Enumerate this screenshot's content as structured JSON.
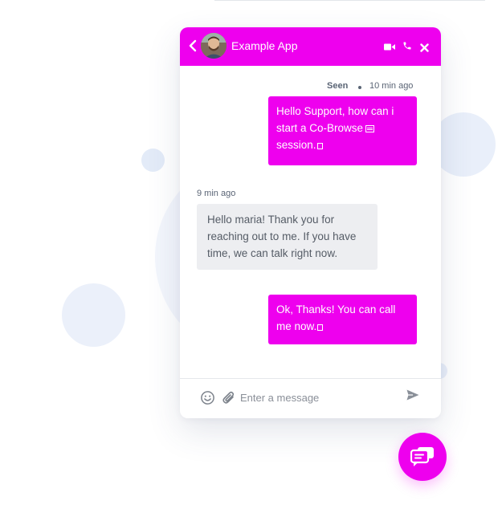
{
  "colors": {
    "accent": "#ee00ee",
    "incoming_bubble": "#edeef1",
    "page": "#ffffff"
  },
  "header": {
    "back_icon": "chevron-left-icon",
    "title": "Example App",
    "icons": [
      "video-camera-icon",
      "phone-icon",
      "close-icon"
    ]
  },
  "messages": {
    "seen_label": "Seen",
    "out1_time": "10 min ago",
    "out1_text": "Hello Support, how can i start a Co-Browse",
    "out1_text_end": "session.",
    "in1_time": "9 min ago",
    "in1_text": "Hello maria! Thank you for reaching out to me. If you have time, we can talk right now.",
    "out2_text": "Ok, Thanks! You can call me now."
  },
  "composer": {
    "placeholder": "Enter a message",
    "value": "",
    "icons": [
      "emoji-icon",
      "paperclip-icon",
      "send-icon"
    ]
  },
  "launcher": {
    "icon": "chat-bubbles-icon"
  }
}
